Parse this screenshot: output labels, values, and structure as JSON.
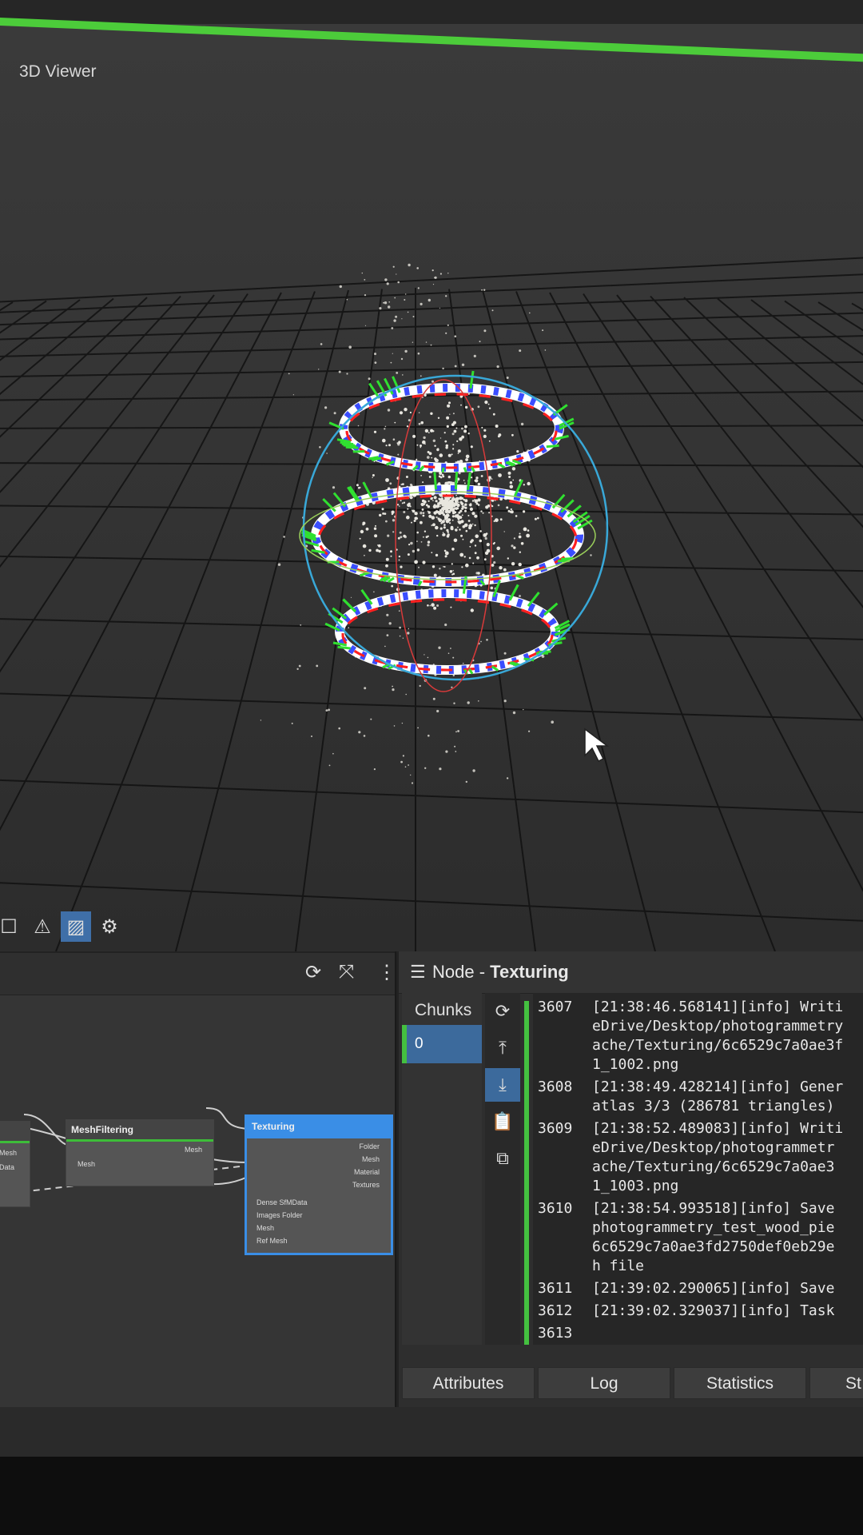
{
  "viewer": {
    "title": "3D Viewer"
  },
  "viewer_toolbar": {
    "icons": [
      "square-icon",
      "warning-icon",
      "grid-stripes-icon",
      "gear-icon"
    ]
  },
  "graph_toolbar": {
    "icons": [
      "refresh-icon",
      "fit-icon",
      "more-vert-icon"
    ]
  },
  "graph": {
    "nodes": [
      {
        "title": "MeshFiltering",
        "outputs": [
          "Mesh"
        ],
        "inputs": [
          "Mesh"
        ]
      },
      {
        "title": "Texturing",
        "outputs": [
          "Folder",
          "Mesh",
          "Material",
          "Textures"
        ],
        "inputs": [
          "Dense SfMData",
          "Images Folder",
          "Mesh",
          "Ref Mesh"
        ]
      }
    ],
    "left_node_ports": [
      "Mesh",
      "Data"
    ]
  },
  "node_panel": {
    "prefix": "Node - ",
    "node_name": "Texturing",
    "chunks_label": "Chunks",
    "selected_chunk": "0",
    "log": [
      {
        "num": "3607",
        "lines": [
          "[21:38:46.568141][info] Writi",
          "eDrive/Desktop/photogrammetry",
          "ache/Texturing/6c6529c7a0ae3f",
          "1_1002.png"
        ]
      },
      {
        "num": "3608",
        "lines": [
          "[21:38:49.428214][info] Gener",
          "atlas 3/3 (286781 triangles)"
        ]
      },
      {
        "num": "3609",
        "lines": [
          "[21:38:52.489083][info] Writi",
          "eDrive/Desktop/photogrammetr",
          "ache/Texturing/6c6529c7a0ae3",
          "1_1003.png"
        ]
      },
      {
        "num": "3610",
        "lines": [
          "[21:38:54.993518][info] Save",
          "photogrammetry_test_wood_pie",
          "6c6529c7a0ae3fd2750def0eb29e",
          "h file"
        ]
      },
      {
        "num": "3611",
        "lines": [
          "[21:39:02.290065][info] Save"
        ]
      },
      {
        "num": "3612",
        "lines": [
          "[21:39:02.329037][info] Task"
        ]
      },
      {
        "num": "3613",
        "lines": [
          ""
        ]
      }
    ],
    "tabs": [
      "Attributes",
      "Log",
      "Statistics",
      "St"
    ]
  },
  "colors": {
    "accent_green": "#44c040",
    "selection_blue": "#3c6a9c",
    "texturing_border": "#3a8ee6"
  }
}
